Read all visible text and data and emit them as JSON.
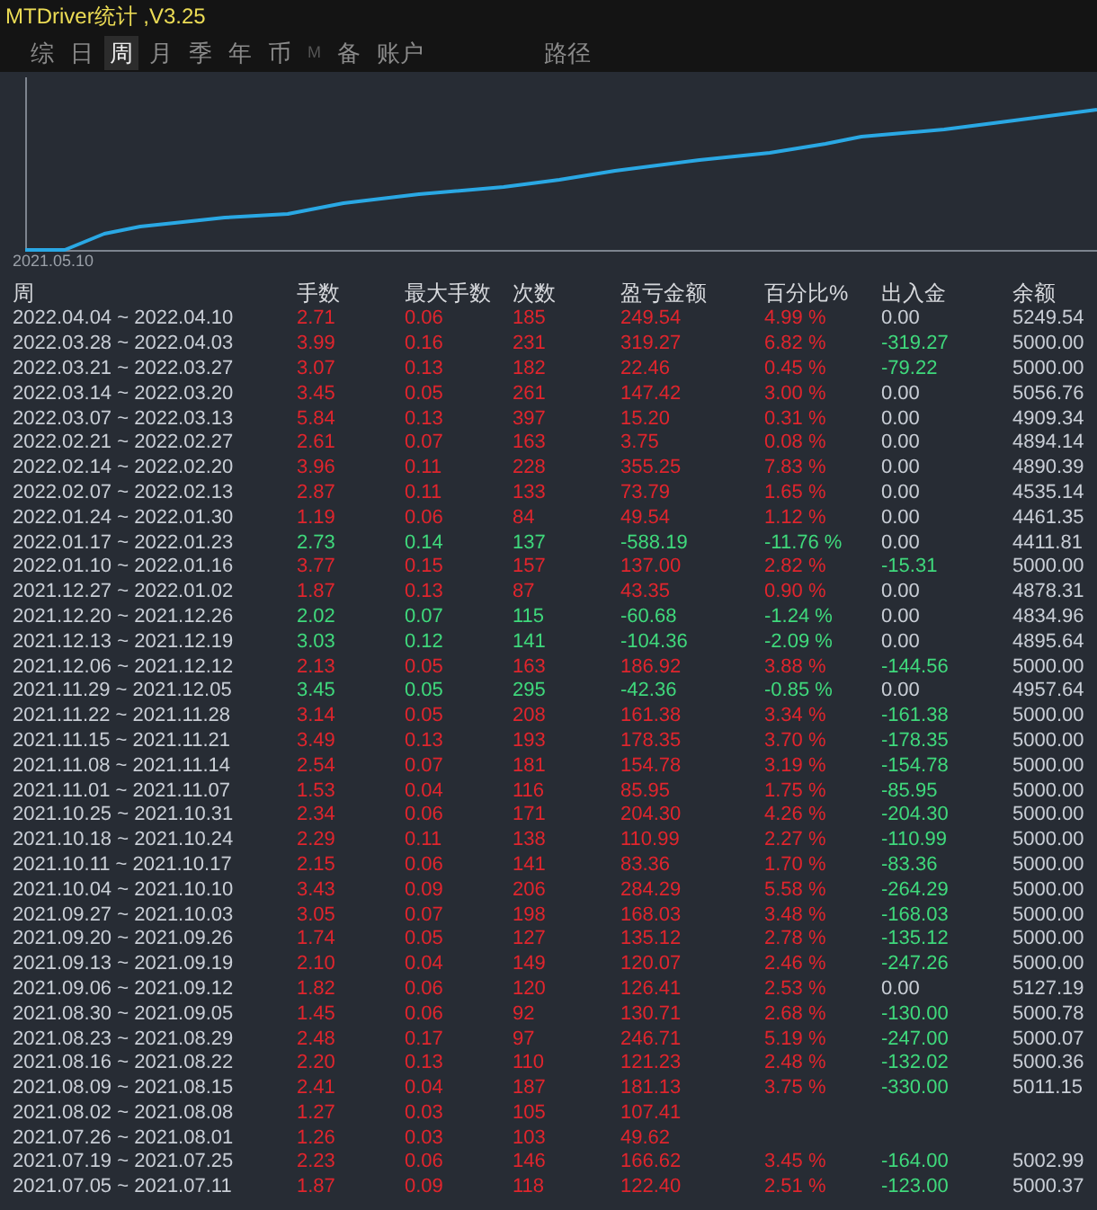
{
  "window": {
    "title": "MTDriver统计 ,V3.25"
  },
  "tabs": [
    {
      "label": "综",
      "selected": false,
      "disabled": false
    },
    {
      "label": "日",
      "selected": false,
      "disabled": false
    },
    {
      "label": "周",
      "selected": true,
      "disabled": false
    },
    {
      "label": "月",
      "selected": false,
      "disabled": false
    },
    {
      "label": "季",
      "selected": false,
      "disabled": false
    },
    {
      "label": "年",
      "selected": false,
      "disabled": false
    },
    {
      "label": "币",
      "selected": false,
      "disabled": false
    },
    {
      "label": "M",
      "selected": false,
      "disabled": true
    },
    {
      "label": "备",
      "selected": false,
      "disabled": false
    },
    {
      "label": "账户",
      "selected": false,
      "disabled": false
    }
  ],
  "path_tab": {
    "label": "路径"
  },
  "chart": {
    "start_label": "2021.05.10"
  },
  "table": {
    "columns": [
      "周",
      "手数",
      "最大手数",
      "次数",
      "盈亏金额",
      "百分比%",
      "出入金",
      "余额"
    ],
    "rows": [
      {
        "week": "2022.04.04 ~ 2022.04.10",
        "lots": "2.71",
        "max_lots": "0.06",
        "trades": "185",
        "profit": "249.54",
        "percent": "4.99 %",
        "transfer": {
          "value": "0.00",
          "withdrawn": false
        },
        "balance": "5249.54",
        "kind": "gain"
      },
      {
        "week": "2022.03.28 ~ 2022.04.03",
        "lots": "3.99",
        "max_lots": "0.16",
        "trades": "231",
        "profit": "319.27",
        "percent": "6.82 %",
        "transfer": {
          "value": "-319.27",
          "withdrawn": true
        },
        "balance": "5000.00",
        "kind": "gain"
      },
      {
        "week": "2022.03.21 ~ 2022.03.27",
        "lots": "3.07",
        "max_lots": "0.13",
        "trades": "182",
        "profit": "22.46",
        "percent": "0.45 %",
        "transfer": {
          "value": "-79.22",
          "withdrawn": true
        },
        "balance": "5000.00",
        "kind": "gain"
      },
      {
        "week": "2022.03.14 ~ 2022.03.20",
        "lots": "3.45",
        "max_lots": "0.05",
        "trades": "261",
        "profit": "147.42",
        "percent": "3.00 %",
        "transfer": {
          "value": "0.00",
          "withdrawn": false
        },
        "balance": "5056.76",
        "kind": "gain"
      },
      {
        "week": "2022.03.07 ~ 2022.03.13",
        "lots": "5.84",
        "max_lots": "0.13",
        "trades": "397",
        "profit": "15.20",
        "percent": "0.31 %",
        "transfer": {
          "value": "0.00",
          "withdrawn": false
        },
        "balance": "4909.34",
        "kind": "gain"
      },
      {
        "week": "2022.02.21 ~ 2022.02.27",
        "lots": "2.61",
        "max_lots": "0.07",
        "trades": "163",
        "profit": "3.75",
        "percent": "0.08 %",
        "transfer": {
          "value": "0.00",
          "withdrawn": false
        },
        "balance": "4894.14",
        "kind": "gain"
      },
      {
        "week": "2022.02.14 ~ 2022.02.20",
        "lots": "3.96",
        "max_lots": "0.11",
        "trades": "228",
        "profit": "355.25",
        "percent": "7.83 %",
        "transfer": {
          "value": "0.00",
          "withdrawn": false
        },
        "balance": "4890.39",
        "kind": "gain"
      },
      {
        "week": "2022.02.07 ~ 2022.02.13",
        "lots": "2.87",
        "max_lots": "0.11",
        "trades": "133",
        "profit": "73.79",
        "percent": "1.65 %",
        "transfer": {
          "value": "0.00",
          "withdrawn": false
        },
        "balance": "4535.14",
        "kind": "gain"
      },
      {
        "week": "2022.01.24 ~ 2022.01.30",
        "lots": "1.19",
        "max_lots": "0.06",
        "trades": "84",
        "profit": "49.54",
        "percent": "1.12 %",
        "transfer": {
          "value": "0.00",
          "withdrawn": false
        },
        "balance": "4461.35",
        "kind": "gain"
      },
      {
        "week": "2022.01.17 ~ 2022.01.23",
        "lots": "2.73",
        "max_lots": "0.14",
        "trades": "137",
        "profit": "-588.19",
        "percent": "-11.76 %",
        "transfer": {
          "value": "0.00",
          "withdrawn": false
        },
        "balance": "4411.81",
        "kind": "loss"
      },
      {
        "week": "2022.01.10 ~ 2022.01.16",
        "lots": "3.77",
        "max_lots": "0.15",
        "trades": "157",
        "profit": "137.00",
        "percent": "2.82 %",
        "transfer": {
          "value": "-15.31",
          "withdrawn": true
        },
        "balance": "5000.00",
        "kind": "gain"
      },
      {
        "week": "2021.12.27 ~ 2022.01.02",
        "lots": "1.87",
        "max_lots": "0.13",
        "trades": "87",
        "profit": "43.35",
        "percent": "0.90 %",
        "transfer": {
          "value": "0.00",
          "withdrawn": false
        },
        "balance": "4878.31",
        "kind": "gain"
      },
      {
        "week": "2021.12.20 ~ 2021.12.26",
        "lots": "2.02",
        "max_lots": "0.07",
        "trades": "115",
        "profit": "-60.68",
        "percent": "-1.24 %",
        "transfer": {
          "value": "0.00",
          "withdrawn": false
        },
        "balance": "4834.96",
        "kind": "loss"
      },
      {
        "week": "2021.12.13 ~ 2021.12.19",
        "lots": "3.03",
        "max_lots": "0.12",
        "trades": "141",
        "profit": "-104.36",
        "percent": "-2.09 %",
        "transfer": {
          "value": "0.00",
          "withdrawn": false
        },
        "balance": "4895.64",
        "kind": "loss"
      },
      {
        "week": "2021.12.06 ~ 2021.12.12",
        "lots": "2.13",
        "max_lots": "0.05",
        "trades": "163",
        "profit": "186.92",
        "percent": "3.88 %",
        "transfer": {
          "value": "-144.56",
          "withdrawn": true
        },
        "balance": "5000.00",
        "kind": "gain"
      },
      {
        "week": "2021.11.29 ~ 2021.12.05",
        "lots": "3.45",
        "max_lots": "0.05",
        "trades": "295",
        "profit": "-42.36",
        "percent": "-0.85 %",
        "transfer": {
          "value": "0.00",
          "withdrawn": false
        },
        "balance": "4957.64",
        "kind": "loss"
      },
      {
        "week": "2021.11.22 ~ 2021.11.28",
        "lots": "3.14",
        "max_lots": "0.05",
        "trades": "208",
        "profit": "161.38",
        "percent": "3.34 %",
        "transfer": {
          "value": "-161.38",
          "withdrawn": true
        },
        "balance": "5000.00",
        "kind": "gain"
      },
      {
        "week": "2021.11.15 ~ 2021.11.21",
        "lots": "3.49",
        "max_lots": "0.13",
        "trades": "193",
        "profit": "178.35",
        "percent": "3.70 %",
        "transfer": {
          "value": "-178.35",
          "withdrawn": true
        },
        "balance": "5000.00",
        "kind": "gain"
      },
      {
        "week": "2021.11.08 ~ 2021.11.14",
        "lots": "2.54",
        "max_lots": "0.07",
        "trades": "181",
        "profit": "154.78",
        "percent": "3.19 %",
        "transfer": {
          "value": "-154.78",
          "withdrawn": true
        },
        "balance": "5000.00",
        "kind": "gain"
      },
      {
        "week": "2021.11.01 ~ 2021.11.07",
        "lots": "1.53",
        "max_lots": "0.04",
        "trades": "116",
        "profit": "85.95",
        "percent": "1.75 %",
        "transfer": {
          "value": "-85.95",
          "withdrawn": true
        },
        "balance": "5000.00",
        "kind": "gain"
      },
      {
        "week": "2021.10.25 ~ 2021.10.31",
        "lots": "2.34",
        "max_lots": "0.06",
        "trades": "171",
        "profit": "204.30",
        "percent": "4.26 %",
        "transfer": {
          "value": "-204.30",
          "withdrawn": true
        },
        "balance": "5000.00",
        "kind": "gain"
      },
      {
        "week": "2021.10.18 ~ 2021.10.24",
        "lots": "2.29",
        "max_lots": "0.11",
        "trades": "138",
        "profit": "110.99",
        "percent": "2.27 %",
        "transfer": {
          "value": "-110.99",
          "withdrawn": true
        },
        "balance": "5000.00",
        "kind": "gain"
      },
      {
        "week": "2021.10.11 ~ 2021.10.17",
        "lots": "2.15",
        "max_lots": "0.06",
        "trades": "141",
        "profit": "83.36",
        "percent": "1.70 %",
        "transfer": {
          "value": "-83.36",
          "withdrawn": true
        },
        "balance": "5000.00",
        "kind": "gain"
      },
      {
        "week": "2021.10.04 ~ 2021.10.10",
        "lots": "3.43",
        "max_lots": "0.09",
        "trades": "206",
        "profit": "284.29",
        "percent": "5.58 %",
        "transfer": {
          "value": "-264.29",
          "withdrawn": true
        },
        "balance": "5000.00",
        "kind": "gain"
      },
      {
        "week": "2021.09.27 ~ 2021.10.03",
        "lots": "3.05",
        "max_lots": "0.07",
        "trades": "198",
        "profit": "168.03",
        "percent": "3.48 %",
        "transfer": {
          "value": "-168.03",
          "withdrawn": true
        },
        "balance": "5000.00",
        "kind": "gain"
      },
      {
        "week": "2021.09.20 ~ 2021.09.26",
        "lots": "1.74",
        "max_lots": "0.05",
        "trades": "127",
        "profit": "135.12",
        "percent": "2.78 %",
        "transfer": {
          "value": "-135.12",
          "withdrawn": true
        },
        "balance": "5000.00",
        "kind": "gain"
      },
      {
        "week": "2021.09.13 ~ 2021.09.19",
        "lots": "2.10",
        "max_lots": "0.04",
        "trades": "149",
        "profit": "120.07",
        "percent": "2.46 %",
        "transfer": {
          "value": "-247.26",
          "withdrawn": true
        },
        "balance": "5000.00",
        "kind": "gain"
      },
      {
        "week": "2021.09.06 ~ 2021.09.12",
        "lots": "1.82",
        "max_lots": "0.06",
        "trades": "120",
        "profit": "126.41",
        "percent": "2.53 %",
        "transfer": {
          "value": "0.00",
          "withdrawn": false
        },
        "balance": "5127.19",
        "kind": "gain"
      },
      {
        "week": "2021.08.30 ~ 2021.09.05",
        "lots": "1.45",
        "max_lots": "0.06",
        "trades": "92",
        "profit": "130.71",
        "percent": "2.68 %",
        "transfer": {
          "value": "-130.00",
          "withdrawn": true
        },
        "balance": "5000.78",
        "kind": "gain"
      },
      {
        "week": "2021.08.23 ~ 2021.08.29",
        "lots": "2.48",
        "max_lots": "0.17",
        "trades": "97",
        "profit": "246.71",
        "percent": "5.19 %",
        "transfer": {
          "value": "-247.00",
          "withdrawn": true
        },
        "balance": "5000.07",
        "kind": "gain"
      },
      {
        "week": "2021.08.16 ~ 2021.08.22",
        "lots": "2.20",
        "max_lots": "0.13",
        "trades": "110",
        "profit": "121.23",
        "percent": "2.48 %",
        "transfer": {
          "value": "-132.02",
          "withdrawn": true
        },
        "balance": "5000.36",
        "kind": "gain"
      },
      {
        "week": "2021.08.09 ~ 2021.08.15",
        "lots": "2.41",
        "max_lots": "0.04",
        "trades": "187",
        "profit": "181.13",
        "percent": "3.75 %",
        "transfer": {
          "value": "-330.00",
          "withdrawn": true
        },
        "balance": "5011.15",
        "kind": "gain"
      },
      {
        "week": "2021.08.02 ~ 2021.08.08",
        "lots": "1.27",
        "max_lots": "0.03",
        "trades": "105",
        "profit": "107.41",
        "kind": "gain"
      },
      {
        "week": "2021.07.26 ~ 2021.08.01",
        "lots": "1.26",
        "max_lots": "0.03",
        "trades": "103",
        "profit": "49.62",
        "kind": "gain"
      },
      {
        "week": "2021.07.19 ~ 2021.07.25",
        "lots": "2.23",
        "max_lots": "0.06",
        "trades": "146",
        "profit": "166.62",
        "percent": "3.45 %",
        "transfer": {
          "value": "-164.00",
          "withdrawn": true
        },
        "balance": "5002.99",
        "kind": "gain"
      },
      {
        "week": "2021.07.05 ~ 2021.07.11",
        "lots": "1.87",
        "max_lots": "0.09",
        "trades": "118",
        "profit": "122.40",
        "percent": "2.51 %",
        "transfer": {
          "value": "-123.00",
          "withdrawn": true
        },
        "balance": "5000.37",
        "kind": "gain"
      }
    ]
  }
}
